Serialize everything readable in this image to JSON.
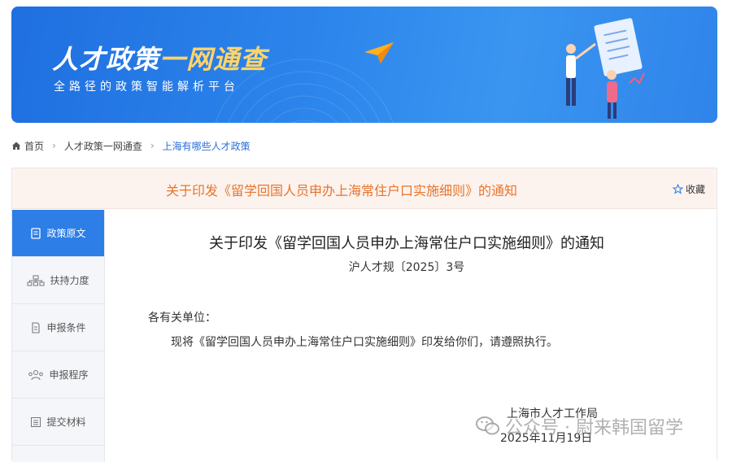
{
  "banner": {
    "title_main": "人才政策",
    "title_accent": "一网通查",
    "subtitle": "全路径的政策智能解析平台"
  },
  "breadcrumb": {
    "home": "首页",
    "level2": "人才政策一网通查",
    "current": "上海有哪些人才政策"
  },
  "header": {
    "title": "关于印发《留学回国人员申办上海常住户口实施细则》的通知",
    "favorite_label": "收藏"
  },
  "sidebar": {
    "items": [
      {
        "label": "政策原文",
        "icon": "document-icon",
        "active": true
      },
      {
        "label": "扶持力度",
        "icon": "org-chart-icon",
        "active": false
      },
      {
        "label": "申报条件",
        "icon": "file-icon",
        "active": false
      },
      {
        "label": "申报程序",
        "icon": "people-icon",
        "active": false
      },
      {
        "label": "提交材料",
        "icon": "list-icon",
        "active": false
      }
    ]
  },
  "document": {
    "title": "关于印发《留学回国人员申办上海常住户口实施细则》的通知",
    "doc_number": "沪人才规〔2025〕3号",
    "greeting": "各有关单位：",
    "paragraph": "现将《留学回国人员申办上海常住户口实施细则》印发给你们，请遵照执行。",
    "issuer": "上海市人才工作局",
    "date": "2025年11月19日"
  },
  "watermark": {
    "text": "公众号 · 尉来韩国留学"
  },
  "colors": {
    "banner_blue": "#2d86ec",
    "accent_orange": "#e8742a",
    "sidebar_active": "#2d7ee6",
    "link_blue": "#2a6fd6"
  }
}
